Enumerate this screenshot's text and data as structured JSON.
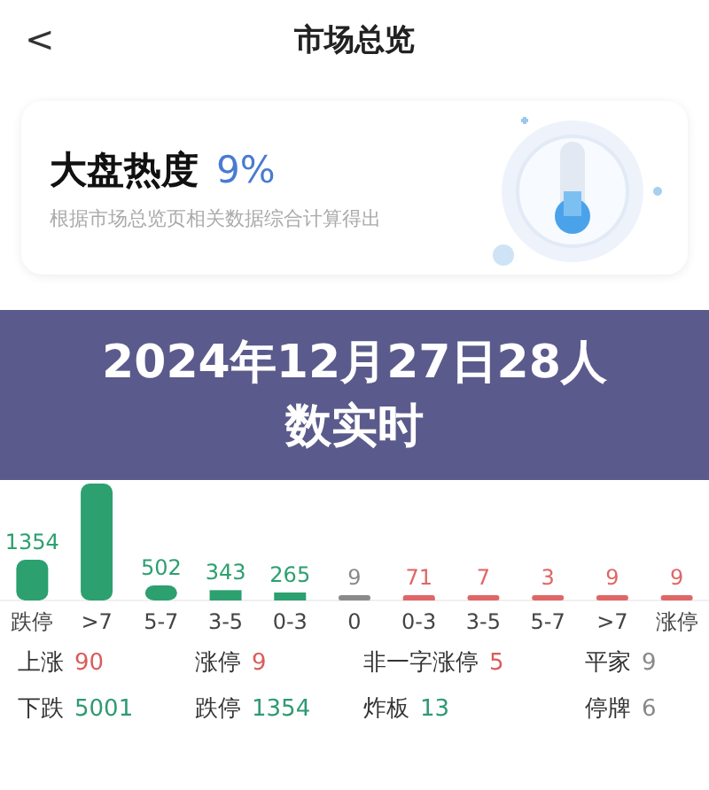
{
  "header": {
    "back": "<",
    "title": "市场总览"
  },
  "heat_card": {
    "title": "大盘热度",
    "value": "9%",
    "subtitle": "根据市场总览页相关数据综合计算得出"
  },
  "distribution": {
    "chart_data": {
      "type": "bar",
      "categories": [
        "跌停",
        ">7",
        "5-7",
        "3-5",
        "0-3",
        "0",
        "0-3",
        "3-5",
        "5-7",
        ">7",
        "涨停"
      ],
      "series": [
        {
          "color": "#2ca06f",
          "values": [
            1354,
            3891,
            502,
            343,
            265,
            null,
            null,
            null,
            null,
            null,
            null
          ],
          "value_labels": [
            "1354",
            null,
            "502",
            "343",
            "265",
            null,
            null,
            null,
            null,
            null,
            null
          ]
        },
        {
          "color": "#8a8a8a",
          "values": [
            null,
            null,
            null,
            null,
            null,
            9,
            null,
            null,
            null,
            null,
            null
          ],
          "value_labels": [
            null,
            null,
            null,
            null,
            null,
            "9",
            null,
            null,
            null,
            null,
            null
          ]
        },
        {
          "color": "#e06666",
          "values": [
            null,
            null,
            null,
            null,
            null,
            null,
            71,
            7,
            3,
            9,
            9
          ],
          "value_labels": [
            null,
            null,
            null,
            null,
            null,
            null,
            "71",
            "7",
            "3",
            "9",
            "9"
          ]
        }
      ]
    }
  },
  "stats": [
    {
      "label": "上涨",
      "value": "90",
      "kind": "up"
    },
    {
      "label": "涨停",
      "value": "9",
      "kind": "up"
    },
    {
      "label": "非一字涨停",
      "value": "5",
      "kind": "up"
    },
    {
      "label": "平家",
      "value": "9",
      "kind": "flat"
    },
    {
      "label": "下跌",
      "value": "5001",
      "kind": "down"
    },
    {
      "label": "跌停",
      "value": "1354",
      "kind": "down"
    },
    {
      "label": "炸板",
      "value": "13",
      "kind": "down"
    },
    {
      "label": "停牌",
      "value": "6",
      "kind": "flat"
    }
  ],
  "banner": {
    "lines": [
      "2024年12月27日28人",
      "数实时"
    ]
  }
}
